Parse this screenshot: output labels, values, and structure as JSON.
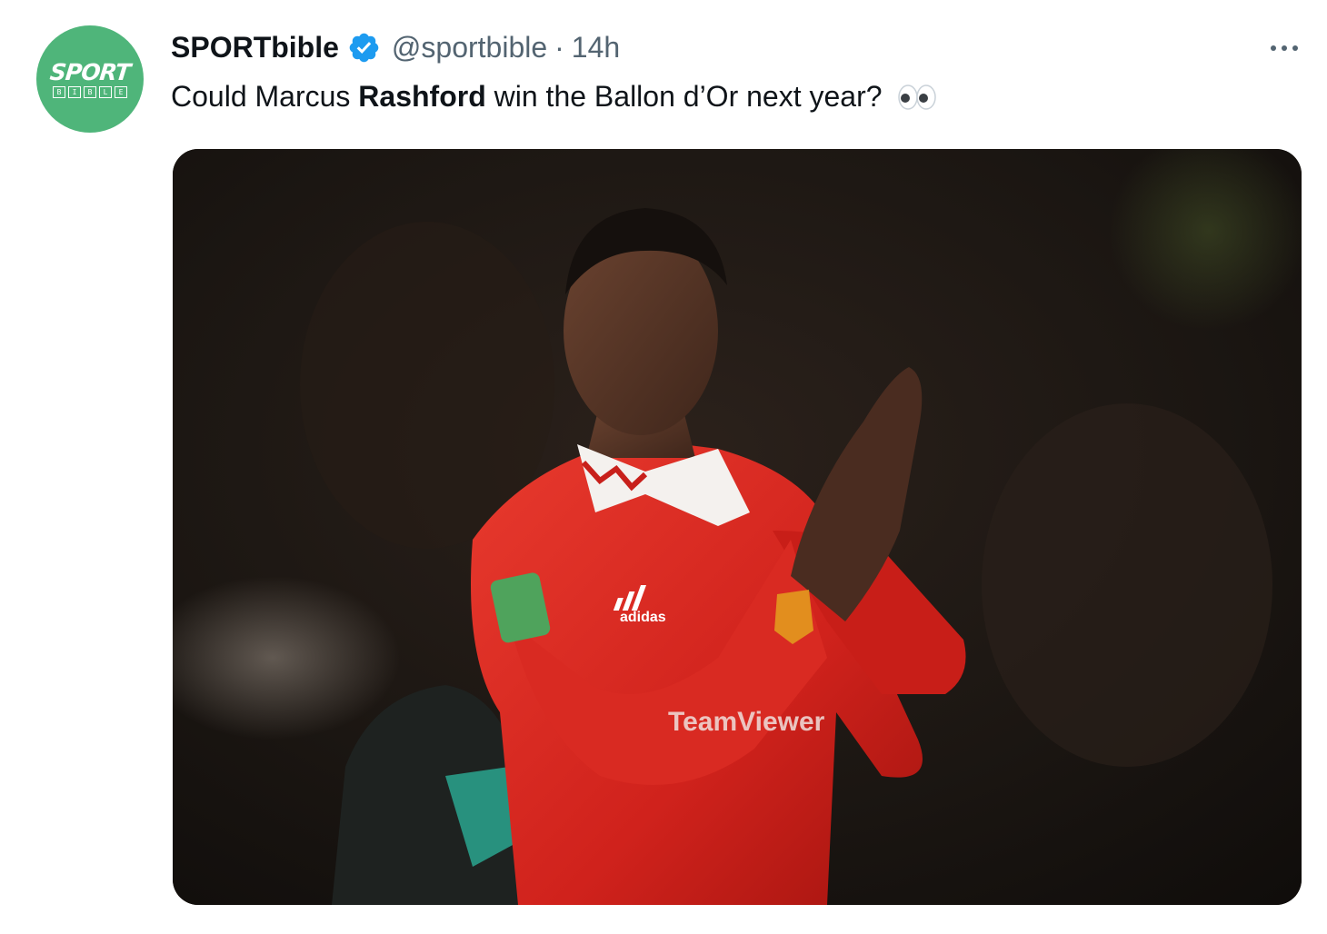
{
  "author": {
    "display_name": "SPORTbible",
    "handle": "@sportbible",
    "separator": "·",
    "time": "14h",
    "avatar_text": "SPORT",
    "avatar_subtext": [
      "B",
      "I",
      "B",
      "L",
      "E"
    ]
  },
  "tweet": {
    "text_before": "Could Marcus ",
    "text_bold": "Rashford",
    "text_after": " win the Ballon d’Or next year?",
    "emoji": "eyes-icon"
  },
  "media": {
    "jersey_sponsor": "TeamViewer",
    "kit_brand": "adidas"
  },
  "colors": {
    "avatar_bg": "#4fb57a",
    "verified": "#1d9bf0",
    "secondary_text": "#536471",
    "primary_text": "#0f1419",
    "jersey_red": "#d8241f"
  }
}
